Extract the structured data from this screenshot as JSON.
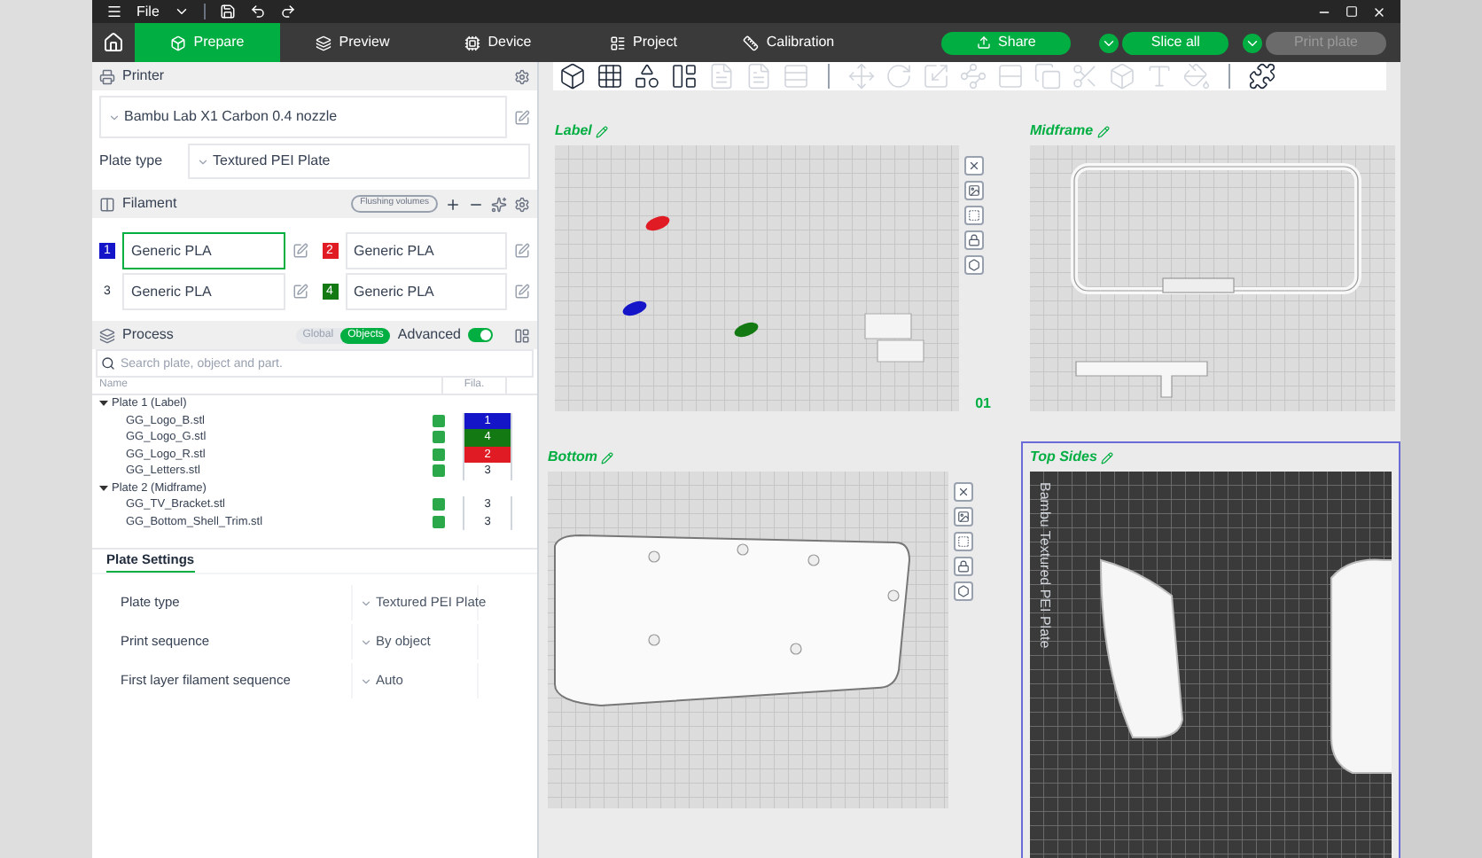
{
  "title_bar": {
    "menu": "File"
  },
  "tabs": [
    {
      "label": "Prepare",
      "selected": true
    },
    {
      "label": "Preview",
      "selected": false
    },
    {
      "label": "Device",
      "selected": false
    },
    {
      "label": "Project",
      "selected": false
    },
    {
      "label": "Calibration",
      "selected": false
    }
  ],
  "actions": [
    {
      "label": "Share",
      "kind": "share",
      "disabled": false
    },
    {
      "label": "Slice all",
      "kind": "split",
      "disabled": false
    },
    {
      "label": "Print plate",
      "kind": "split",
      "disabled": true
    }
  ],
  "printer": {
    "title": "Printer",
    "preset": "Bambu Lab X1 Carbon 0.4 nozzle",
    "plate_type_label": "Plate type",
    "plate_type": "Textured PEI Plate"
  },
  "filament": {
    "title": "Filament",
    "flushing": "Flushing volumes",
    "slots": [
      {
        "number": "1",
        "name": "Generic PLA",
        "color": "#1414c8",
        "selected": true
      },
      {
        "number": "2",
        "name": "Generic PLA",
        "color": "#e01b24",
        "selected": false
      },
      {
        "number": "3",
        "name": "Generic PLA",
        "color": "#ffffff",
        "selected": false
      },
      {
        "number": "4",
        "name": "Generic PLA",
        "color": "#137a13",
        "selected": false
      }
    ]
  },
  "process": {
    "title": "Process",
    "scopes": [
      {
        "label": "Global",
        "selected": false
      },
      {
        "label": "Objects",
        "selected": true
      }
    ],
    "advanced_label": "Advanced",
    "advanced_on": true,
    "search_placeholder": "Search plate, object and part."
  },
  "objects": {
    "columns": [
      "Name",
      "Fila."
    ],
    "plates": [
      {
        "name": "Plate 1 (Label)",
        "expanded": true,
        "children": [
          {
            "name": "GG_Logo_B.stl",
            "checked": true,
            "filament": "1",
            "color": "#1414c8"
          },
          {
            "name": "GG_Logo_G.stl",
            "checked": true,
            "filament": "4",
            "color": "#137a13"
          },
          {
            "name": "GG_Logo_R.stl",
            "checked": true,
            "filament": "2",
            "color": "#e01b24"
          },
          {
            "name": "GG_Letters.stl",
            "checked": true,
            "filament": "3",
            "color": "#ffffff"
          }
        ]
      },
      {
        "name": "Plate 2 (Midframe)",
        "expanded": true,
        "children": [
          {
            "name": "GG_TV_Bracket.stl",
            "checked": true,
            "filament": "3",
            "color": "#ffffff"
          },
          {
            "name": "GG_Bottom_Shell_Trim.stl",
            "checked": true,
            "filament": "3",
            "color": "#ffffff"
          }
        ]
      }
    ]
  },
  "plate_settings": {
    "title": "Plate Settings",
    "rows": [
      {
        "label": "Plate type",
        "value": "Textured PEI Plate"
      },
      {
        "label": "Print sequence",
        "value": "By object"
      },
      {
        "label": "First layer filament sequence",
        "value": "Auto"
      }
    ]
  },
  "viewport": {
    "plates": [
      {
        "name": "Label",
        "kind": "label",
        "number": "01",
        "selected": false
      },
      {
        "name": "Midframe",
        "kind": "midframe",
        "selected": false
      },
      {
        "name": "Bottom",
        "kind": "bottom",
        "selected": false
      },
      {
        "name": "Top Sides",
        "kind": "sides",
        "selected": true,
        "plate_text": "Bambu Textured PEI Plate"
      }
    ]
  }
}
